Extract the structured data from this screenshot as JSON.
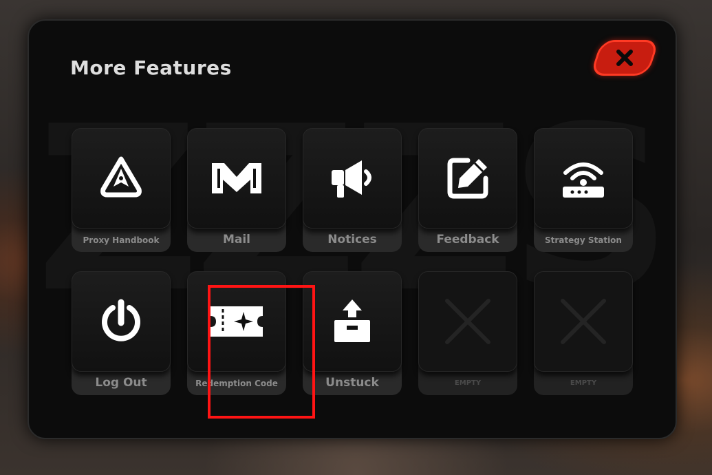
{
  "dialog": {
    "title": "More Features",
    "close_icon": "close-x-icon",
    "accent_color": "#c81d10",
    "highlight_color": "#ff1414"
  },
  "tiles": [
    {
      "label": "Proxy Handbook",
      "icon": "compass-icon",
      "size": "small"
    },
    {
      "label": "Mail",
      "icon": "mail-m-icon",
      "size": "big"
    },
    {
      "label": "Notices",
      "icon": "megaphone-icon",
      "size": "big"
    },
    {
      "label": "Feedback",
      "icon": "edit-pencil-icon",
      "size": "big"
    },
    {
      "label": "Strategy Station",
      "icon": "router-signal-icon",
      "size": "small"
    },
    {
      "label": "Log Out",
      "icon": "power-icon",
      "size": "big"
    },
    {
      "label": "Redemption Code",
      "icon": "ticket-star-icon",
      "size": "small",
      "highlighted": true
    },
    {
      "label": "Unstuck",
      "icon": "box-arrow-up-icon",
      "size": "big"
    },
    {
      "label": "EMPTY",
      "icon": "x-mark-icon",
      "size": "empty"
    },
    {
      "label": "EMPTY",
      "icon": "x-mark-icon",
      "size": "empty"
    }
  ]
}
